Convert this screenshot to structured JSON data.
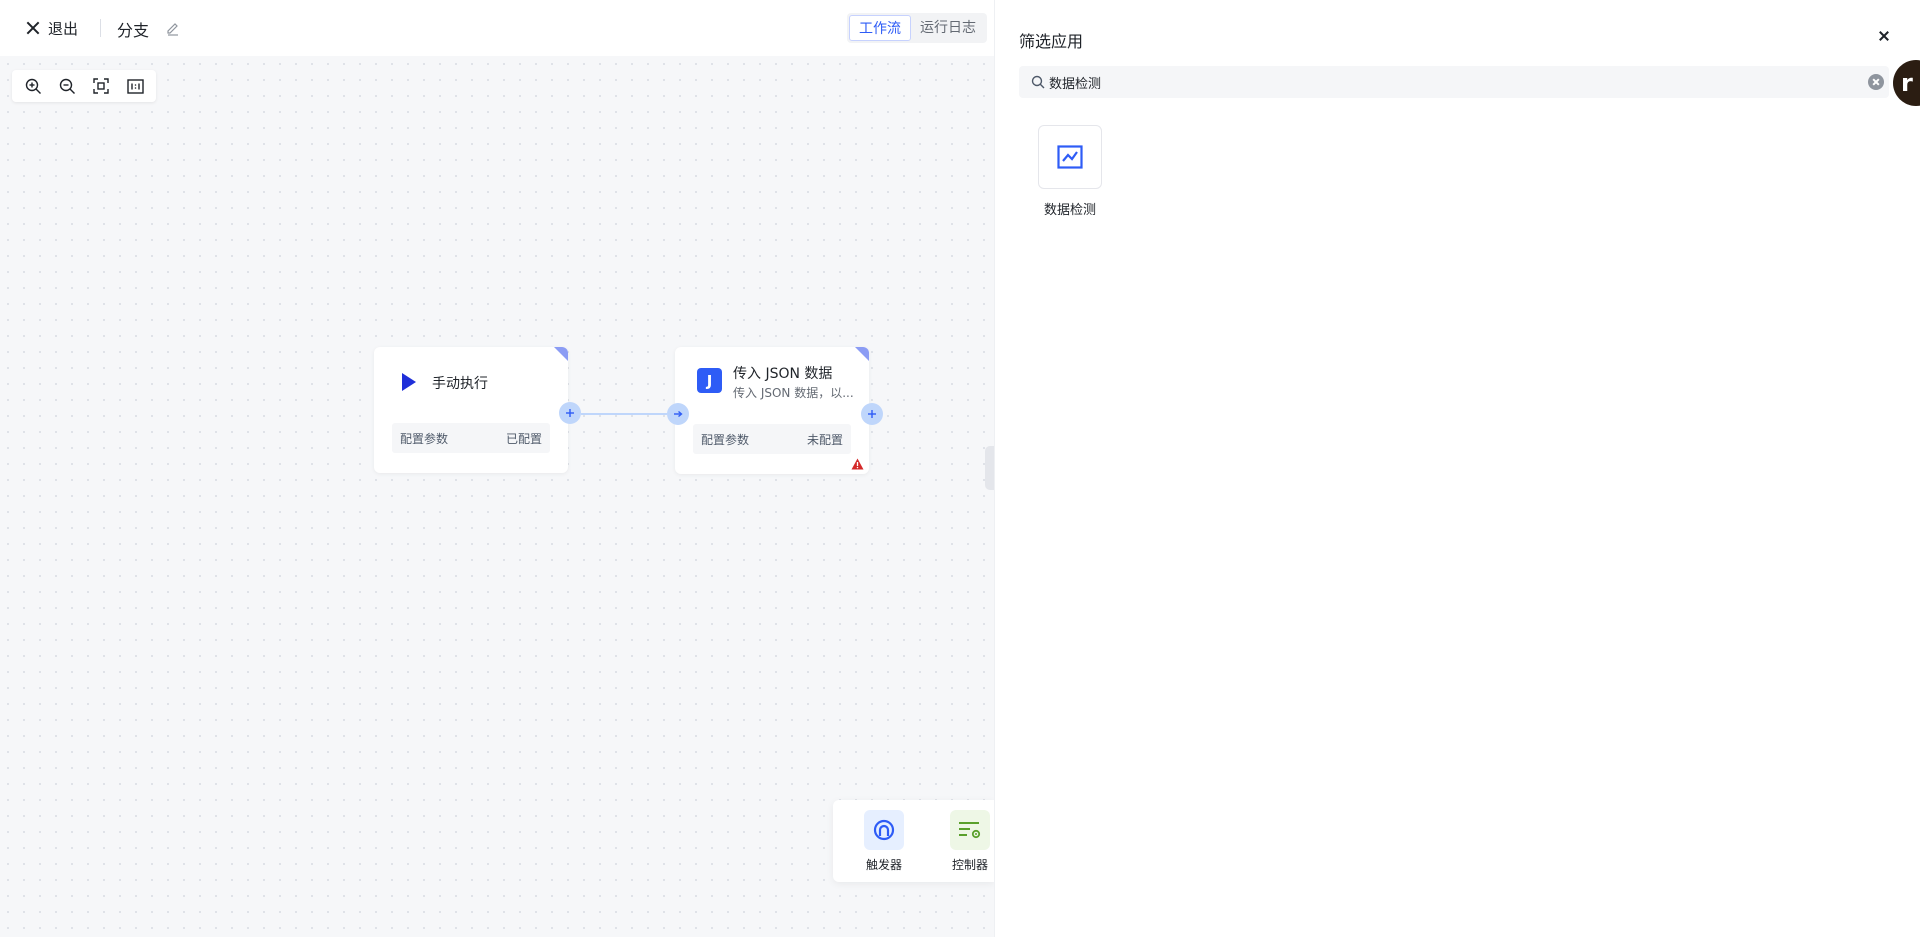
{
  "topbar": {
    "exit_label": "退出",
    "workflow_title": "分支",
    "tabs": [
      {
        "label": "工作流",
        "active": true
      },
      {
        "label": "运行日志",
        "active": false
      }
    ]
  },
  "canvas": {
    "zoom_controls": [
      "zoom-in-icon",
      "zoom-out-icon",
      "fit-view-icon",
      "actual-size-icon"
    ],
    "nodes": [
      {
        "icon": "play-icon",
        "title": "手动执行",
        "config_label": "配置参数",
        "config_status": "已配置",
        "warning": false
      },
      {
        "icon": "json-icon",
        "icon_text": "J",
        "title": "传入 JSON 数据",
        "subtitle": "传入 JSON 数据，以...",
        "config_label": "配置参数",
        "config_status": "未配置",
        "warning": true
      }
    ],
    "palette": [
      {
        "icon": "trigger-icon",
        "label": "触发器"
      },
      {
        "icon": "controller-icon",
        "label": "控制器"
      }
    ]
  },
  "panel": {
    "title": "筛选应用",
    "search_value": "数据检测",
    "results": [
      {
        "icon": "line-chart-icon",
        "label": "数据检测"
      }
    ]
  },
  "avatar": {
    "initial": "r"
  },
  "colors": {
    "accent": "#2e5cf6",
    "port": "#bfd6fb",
    "node_corner": "#8b9cf4",
    "warning": "#d42a2a",
    "controller_bg": "#eef7e6",
    "trigger_bg": "#e6efff"
  }
}
